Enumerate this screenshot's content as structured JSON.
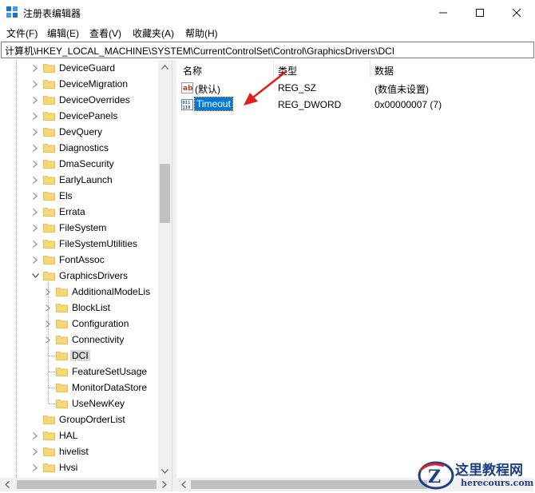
{
  "window": {
    "title": "注册表编辑器",
    "minimize_icon": "minimize-icon",
    "maximize_icon": "maximize-icon",
    "close_icon": "close-icon"
  },
  "menu": [
    "文件(F)",
    "编辑(E)",
    "查看(V)",
    "收藏夹(A)",
    "帮助(H)"
  ],
  "address": "计算机\\HKEY_LOCAL_MACHINE\\SYSTEM\\CurrentControlSet\\Control\\GraphicsDrivers\\DCI",
  "tree": {
    "items": [
      {
        "label": "DeviceGuard",
        "level": 0,
        "expander": "collapsed"
      },
      {
        "label": "DeviceMigration",
        "level": 0,
        "expander": "collapsed"
      },
      {
        "label": "DeviceOverrides",
        "level": 0,
        "expander": "collapsed"
      },
      {
        "label": "DevicePanels",
        "level": 0,
        "expander": "collapsed"
      },
      {
        "label": "DevQuery",
        "level": 0,
        "expander": "collapsed"
      },
      {
        "label": "Diagnostics",
        "level": 0,
        "expander": "collapsed"
      },
      {
        "label": "DmaSecurity",
        "level": 0,
        "expander": "collapsed"
      },
      {
        "label": "EarlyLaunch",
        "level": 0,
        "expander": "collapsed"
      },
      {
        "label": "Els",
        "level": 0,
        "expander": "collapsed"
      },
      {
        "label": "Errata",
        "level": 0,
        "expander": "collapsed"
      },
      {
        "label": "FileSystem",
        "level": 0,
        "expander": "collapsed"
      },
      {
        "label": "FileSystemUtilities",
        "level": 0,
        "expander": "collapsed"
      },
      {
        "label": "FontAssoc",
        "level": 0,
        "expander": "collapsed"
      },
      {
        "label": "GraphicsDrivers",
        "level": 0,
        "expander": "expanded"
      },
      {
        "label": "AdditionalModeLis",
        "level": 1,
        "expander": "collapsed"
      },
      {
        "label": "BlockList",
        "level": 1,
        "expander": "collapsed"
      },
      {
        "label": "Configuration",
        "level": 1,
        "expander": "collapsed"
      },
      {
        "label": "Connectivity",
        "level": 1,
        "expander": "collapsed"
      },
      {
        "label": "DCI",
        "level": 1,
        "expander": "none",
        "selected": true
      },
      {
        "label": "FeatureSetUsage",
        "level": 1,
        "expander": "none"
      },
      {
        "label": "MonitorDataStore",
        "level": 1,
        "expander": "none"
      },
      {
        "label": "UseNewKey",
        "level": 1,
        "expander": "none"
      },
      {
        "label": "GroupOrderList",
        "level": 0,
        "expander": "none"
      },
      {
        "label": "HAL",
        "level": 0,
        "expander": "collapsed"
      },
      {
        "label": "hivelist",
        "level": 0,
        "expander": "collapsed"
      },
      {
        "label": "Hvsi",
        "level": 0,
        "expander": "collapsed"
      }
    ]
  },
  "list": {
    "columns": {
      "name": "名称",
      "type": "类型",
      "data": "数据"
    },
    "rows": [
      {
        "name": "(默认)",
        "type": "REG_SZ",
        "data": "(数值未设置)",
        "icon": "string-value-icon"
      },
      {
        "name": "Timeout",
        "type": "REG_DWORD",
        "data": "0x00000007 (7)",
        "icon": "binary-value-icon",
        "selected": true
      }
    ]
  },
  "watermark": {
    "title": "这里教程网",
    "url": "herecours.com"
  },
  "colors": {
    "selection": "#0078d7",
    "arrow": "#e0201b",
    "folder": "#f8d775",
    "watermark": "#1c3f86"
  }
}
